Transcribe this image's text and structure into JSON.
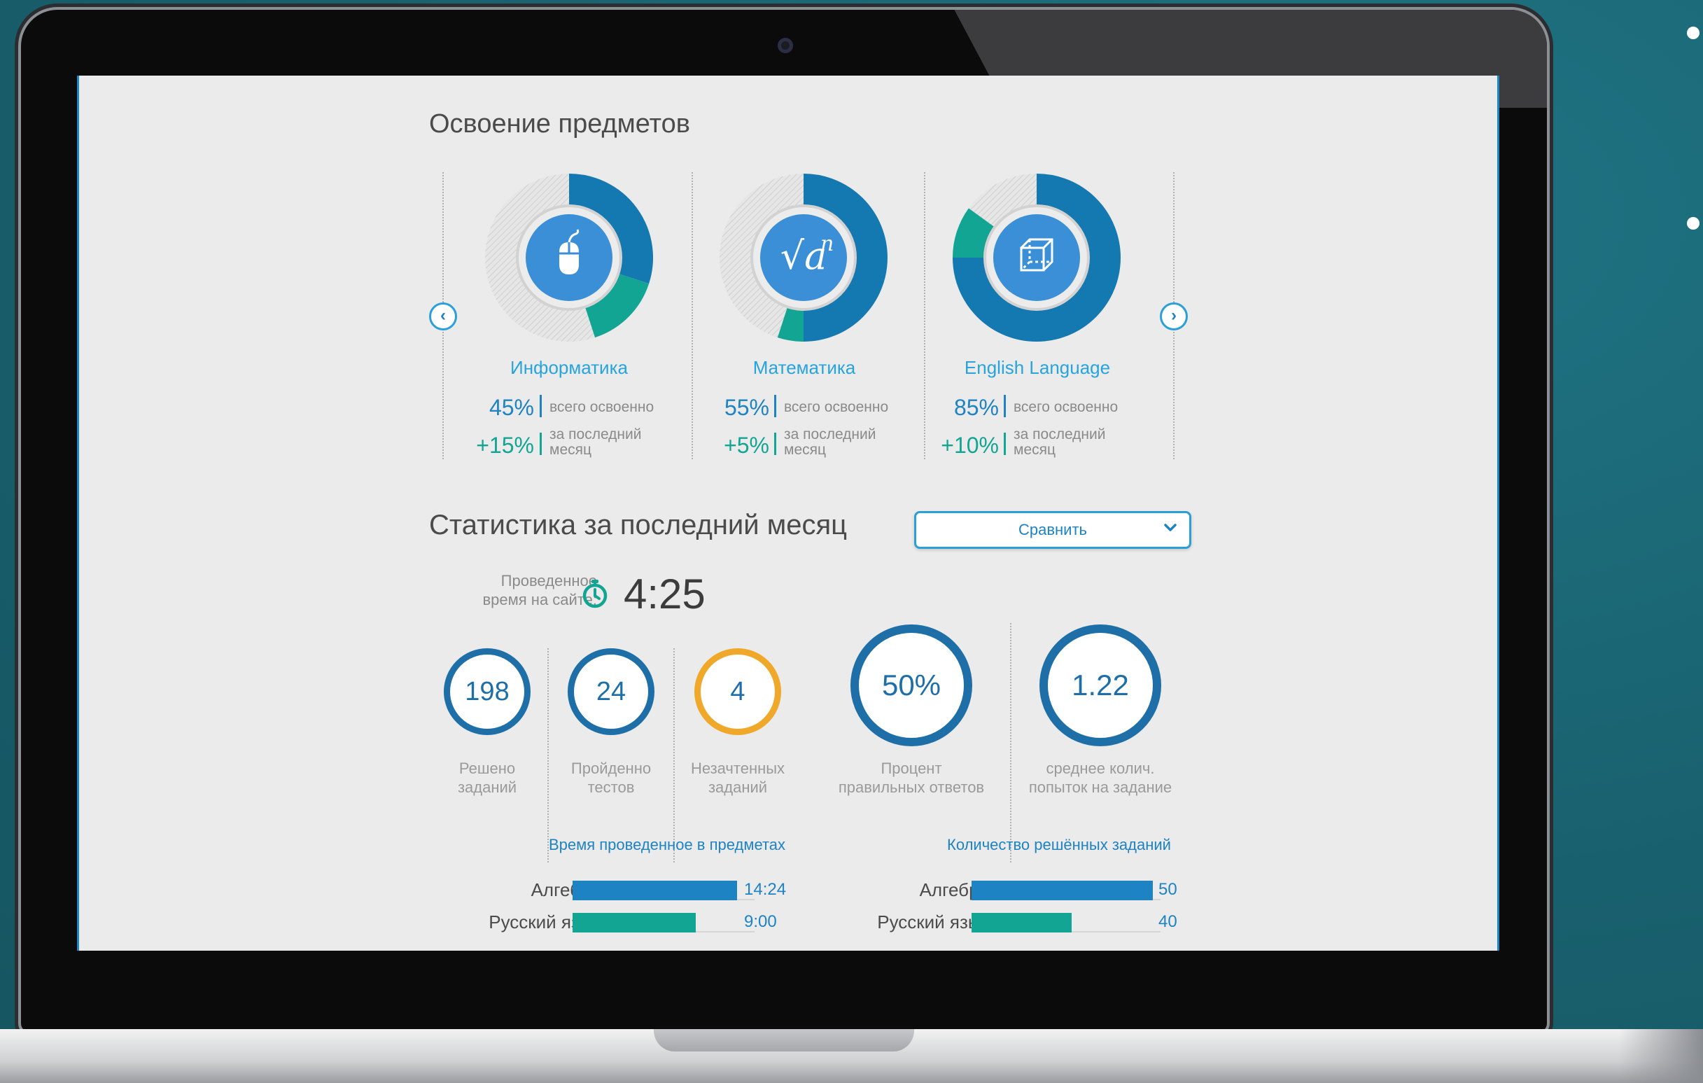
{
  "colors": {
    "accent": "#1e83c2",
    "green": "#12a593",
    "orange": "#f0a82a",
    "background": "#1a6472"
  },
  "mastery": {
    "title": "Освоение предметов",
    "total_label": "всего освоенно",
    "month_label_1": "за последний",
    "month_label_2": "месяц",
    "subjects": [
      {
        "name": "Информатика",
        "icon": "computer-mouse-icon",
        "mastered": "45%",
        "gain": "+15%",
        "mastered_value": 45,
        "gain_value": 15
      },
      {
        "name": "Математика",
        "icon": "square-root-icon",
        "mastered": "55%",
        "gain": "+5%",
        "mastered_value": 55,
        "gain_value": 5
      },
      {
        "name": "English Language",
        "icon": "cube-icon",
        "mastered": "85%",
        "gain": "+10%",
        "mastered_value": 85,
        "gain_value": 10
      }
    ]
  },
  "stats": {
    "title": "Статистика за последний месяц",
    "compare_label": "Сравнить",
    "time_label_1": "Проведенное",
    "time_label_2": "время на сайте:",
    "time_value": "4:25",
    "rings": [
      {
        "value": "198",
        "label_1": "Решено",
        "label_2": "заданий",
        "color": "#1e6fa8"
      },
      {
        "value": "24",
        "label_1": "Пройденно",
        "label_2": "тестов",
        "color": "#1e6fa8"
      },
      {
        "value": "4",
        "label_1": "Незачтенных",
        "label_2": "заданий",
        "color": "#f0a82a"
      },
      {
        "value": "50%",
        "label_1": "Процент",
        "label_2": "правильных ответов",
        "color": "#1e6fa8"
      },
      {
        "value": "1.22",
        "label_1": "среднее колич.",
        "label_2": "попыток на задание",
        "color": "#1e6fa8"
      }
    ]
  },
  "time_chart": {
    "title": "Время проведенное в предметах",
    "rows": [
      {
        "category": "Алгебра",
        "value_label": "14:24",
        "fraction": 1.0,
        "color": "#1e83c2"
      },
      {
        "category": "Русский язык",
        "value_label": "9:00",
        "fraction": 0.75,
        "color": "#12a593"
      }
    ]
  },
  "tasks_chart": {
    "title": "Количество решённых заданий",
    "rows": [
      {
        "category": "Алгебра",
        "value_label": "50",
        "value": 50,
        "fraction": 0.94,
        "color": "#1e83c2"
      },
      {
        "category": "Русский язык",
        "value_label": "40",
        "value": 40,
        "fraction": 0.52,
        "color": "#12a593"
      }
    ]
  }
}
